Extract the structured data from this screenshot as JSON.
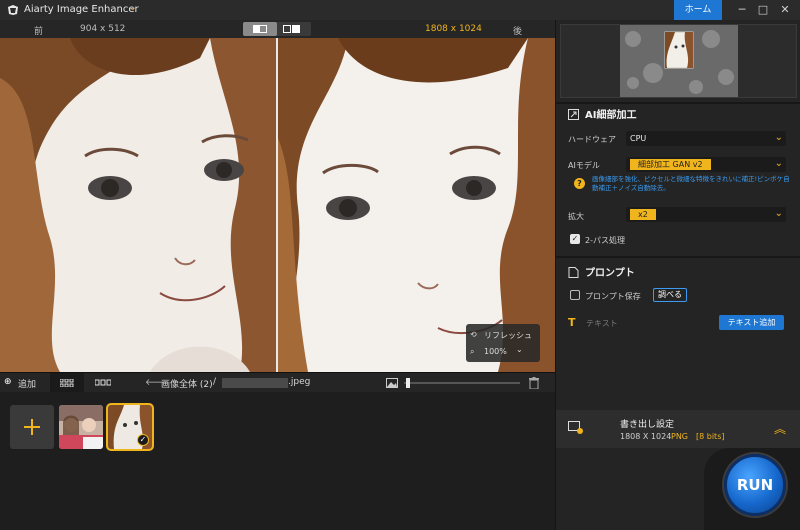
{
  "app": {
    "title": "Aiarty Image Enhancer",
    "title_dropdown_icon": "chevron-down-icon",
    "home_label": "ホーム",
    "window_controls": {
      "minimize": "─",
      "maximize": "□",
      "close": "✕"
    }
  },
  "compare": {
    "before_label": "前",
    "before_size": "904 x 512",
    "after_size": "1808 x 1024",
    "after_label": "後",
    "accent": "#f0b41d"
  },
  "viewer": {
    "refresh_label": "リフレッシュ",
    "zoom_value": "100%",
    "zoom_dd": "⌄"
  },
  "thumbbar": {
    "add_label": "追加",
    "breadcrumb_label": "画像全体 (2)",
    "breadcrumb_sep": "/",
    "file_ext": ".jpeg",
    "back_arrow": "🡐"
  },
  "panel": {
    "ai_section_title": "AI細部加工",
    "hardware_label": "ハードウェア",
    "hardware_value": "CPU",
    "ai_model_label": "AIモデル",
    "ai_model_value": "細部加工 GAN v2",
    "ai_model_hint": "画像細部を強化、ピクセルと微細な特徴をきれいに補正!ピンボケ自動補正＋ノイズ自動除去。",
    "scale_label": "拡大",
    "scale_value": "x2",
    "two_pass_label": "2-パス処理",
    "two_pass_checked": true,
    "prompt_section_title": "プロンプト",
    "prompt_save_label": "プロンプト保存",
    "prompt_save_checked": false,
    "inspect_label": "調べる",
    "text_label": "テキスト",
    "add_text_label": "テキスト追加",
    "export_title": "書き出し設定",
    "export_size": "1808 X 1024",
    "export_format": "PNG",
    "export_bits": "[8 bits]",
    "run_label": "RUN"
  }
}
